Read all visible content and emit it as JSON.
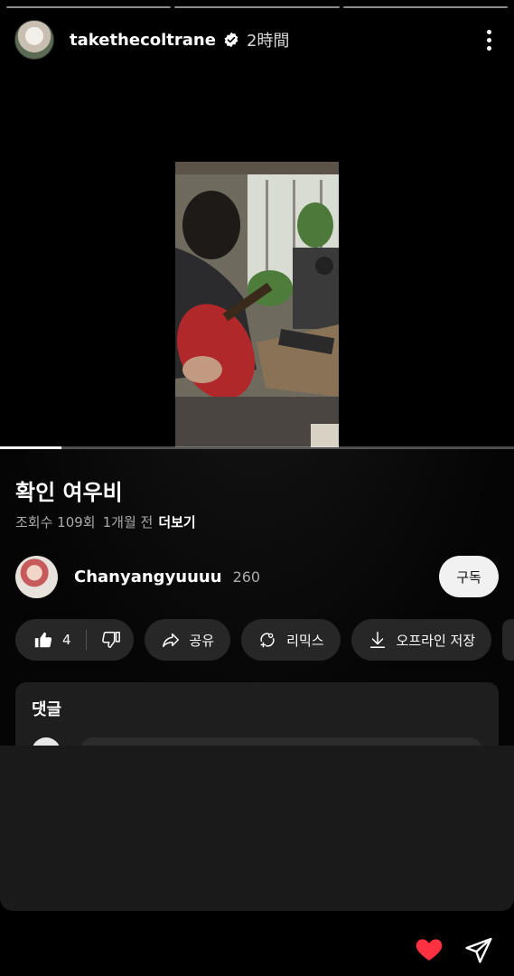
{
  "story": {
    "username": "takethecoltrane",
    "time": "2時間",
    "progress_segments": 3
  },
  "video": {
    "title": "확인 여우비",
    "views": "조회수 109회",
    "age": "1개월 전",
    "more_label": "더보기",
    "progress_fraction": 0.12
  },
  "channel": {
    "name": "Chanyangyuuuu",
    "subscribers": "260",
    "subscribe_label": "구독"
  },
  "actions": {
    "like_count": "4",
    "share_label": "공유",
    "remix_label": "리믹스",
    "download_label": "오프라인 저장"
  },
  "comments": {
    "label": "댓글"
  },
  "colors": {
    "heart": "#ff3040",
    "background": "#000000",
    "pill": "#272727"
  }
}
